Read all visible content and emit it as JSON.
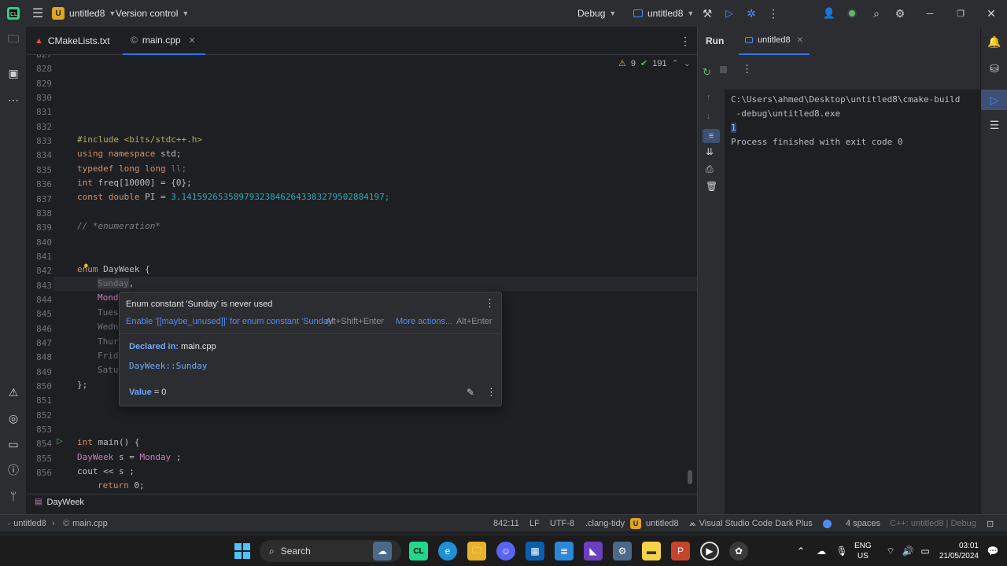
{
  "titlebar": {
    "project_badge": "U",
    "project_name": "untitled8",
    "vcs": "Version control",
    "build_config": "Debug",
    "run_target": "untitled8"
  },
  "tabs": [
    {
      "label": "CMakeLists.txt",
      "icon": "cmake-icon",
      "active": false
    },
    {
      "label": "main.cpp",
      "icon": "cpp-file-icon",
      "active": true
    }
  ],
  "inspections": {
    "warnings": "9",
    "ok": "191"
  },
  "editor_lines": [
    {
      "n": "827"
    },
    {
      "n": "828"
    },
    {
      "n": "829"
    },
    {
      "n": "830"
    },
    {
      "n": "831"
    },
    {
      "n": "832"
    },
    {
      "n": "833"
    },
    {
      "n": "834"
    },
    {
      "n": "835"
    },
    {
      "n": "836"
    },
    {
      "n": "837"
    },
    {
      "n": "838"
    },
    {
      "n": "839"
    },
    {
      "n": "840"
    },
    {
      "n": "841"
    },
    {
      "n": "842"
    },
    {
      "n": "843"
    },
    {
      "n": "844"
    },
    {
      "n": "845"
    },
    {
      "n": "846"
    },
    {
      "n": "847"
    },
    {
      "n": "848"
    },
    {
      "n": "849"
    },
    {
      "n": "850"
    },
    {
      "n": "851"
    },
    {
      "n": "852"
    },
    {
      "n": "853"
    },
    {
      "n": "854"
    },
    {
      "n": "855"
    },
    {
      "n": "856"
    }
  ],
  "code": {
    "l832": "#include <bits/stdc++.h>",
    "l833a": "using namespace",
    "l833b": " std;",
    "l834a": "typedef long long",
    "l834b": " ll;",
    "l835a": "int",
    "l835b": " freq[10000] = {0};",
    "l836a": "const double",
    "l836b": " PI = ",
    "l836c": "3.14159265358979323846264338327950288419",
    "l836d": "7;",
    "l838": "// *enumeration*",
    "l841a": "enum",
    "l841b": " DayWeek {",
    "l842": "Sunday",
    "l842b": ",",
    "l843": "Mond",
    "l844": "Tues",
    "l845": "Wedn",
    "l846": "Thur",
    "l847": "Frid",
    "l848": "Satu",
    "l849": "};",
    "l853a": "int",
    "l853b": " main() {",
    "l854a": "DayWeek",
    "l854b": " s = ",
    "l854c": "Monday",
    "l854d": " ;",
    "l855a": "cout << s ;",
    "l856a": "return",
    "l856b": " 0;"
  },
  "popup": {
    "message": "Enum constant 'Sunday' is never used",
    "fix": "Enable '[[maybe_unused]]' for enum constant 'Sunday'",
    "fix_shortcut": "Alt+Shift+Enter",
    "more": "More actions...",
    "more_shortcut": "Alt+Enter",
    "declared_label": "Declared in:",
    "declared_file": "main.cpp",
    "qualified": "DayWeek::Sunday",
    "value_label": "Value",
    "value": " = 0"
  },
  "breadcrumb": "DayWeek",
  "run": {
    "title": "Run",
    "tab": "untitled8",
    "output_lines": [
      "C:\\Users\\ahmed\\Desktop\\untitled8\\cmake-build",
      " -debug\\untitled8.exe",
      "1",
      "Process finished with exit code 0"
    ]
  },
  "status": {
    "project": "untitled8",
    "file": "main.cpp",
    "position": "842:11",
    "line_sep": "LF",
    "encoding": "UTF-8",
    "linter": ".clang-tidy",
    "project2": "untitled8",
    "theme": "Visual Studio Code Dark Plus",
    "indent": "4 spaces",
    "context": "C++: untitled8 | Debug"
  },
  "taskbar": {
    "search": "Search",
    "lang1": "ENG",
    "lang2": "US",
    "time": "03:01",
    "date": "21/05/2024"
  },
  "colors": {
    "accent": "#3574f0",
    "warning": "#e5b84a",
    "project_badge": "#e1a524"
  }
}
